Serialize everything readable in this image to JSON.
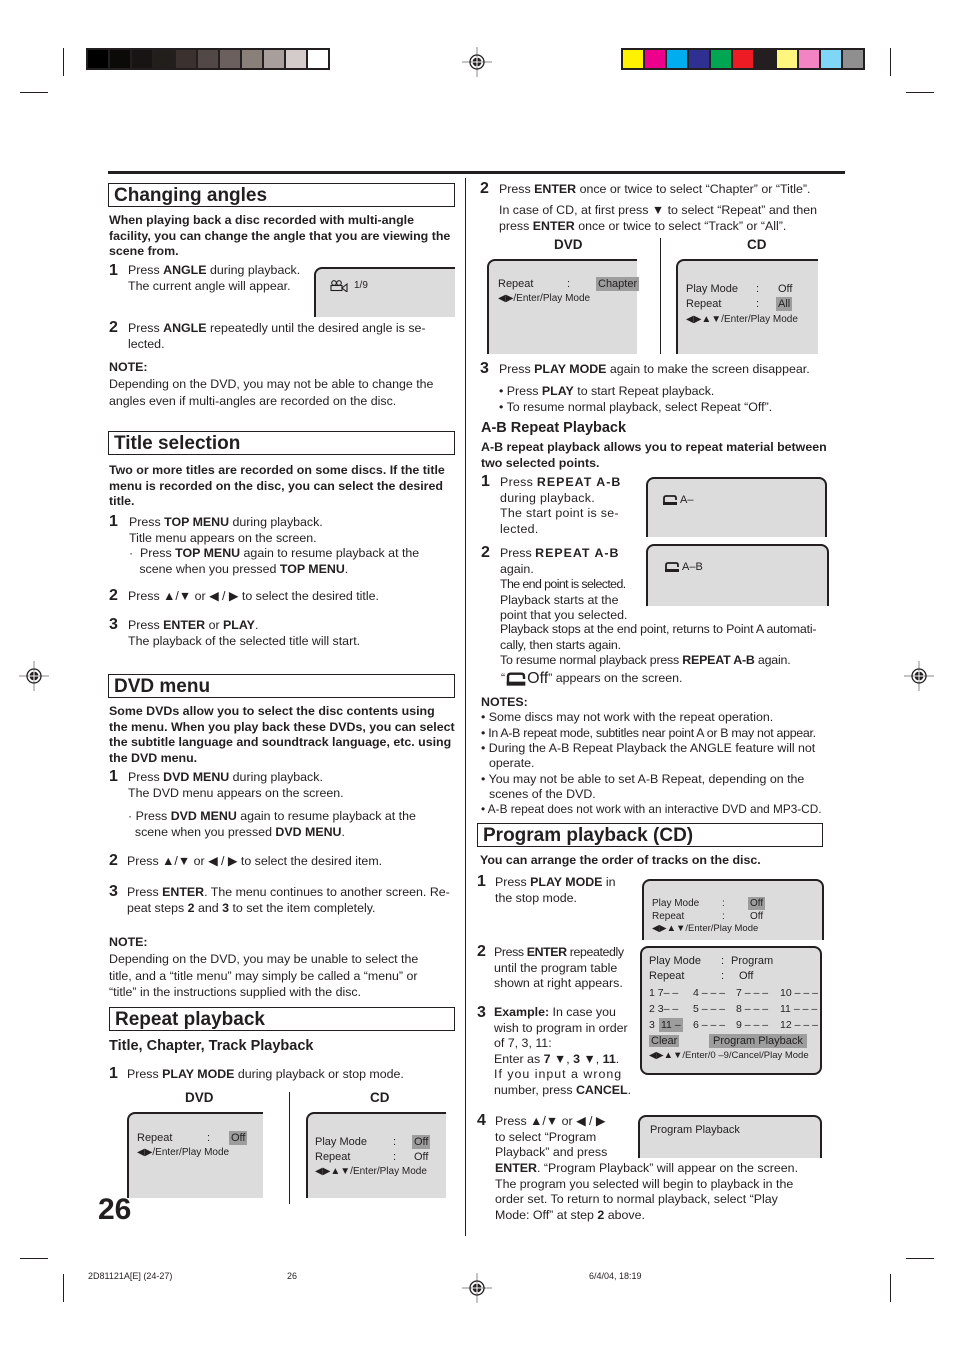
{
  "print_marks": {
    "gray_swatches": [
      "#000000",
      "#0c0a09",
      "#181413",
      "#221e1c",
      "#3b3230",
      "#524845",
      "#6b605d",
      "#888079",
      "#a89f9c",
      "#d3cccb",
      "#ffffff"
    ],
    "color_swatches": [
      "#fff200",
      "#ec008c",
      "#00aeef",
      "#2e3192",
      "#00a651",
      "#ed1c24",
      "#231f20",
      "#fff67f",
      "#f384c3",
      "#7fd6f7",
      "#8f8f8f"
    ]
  },
  "left": {
    "changing_angles": {
      "title": "Changing angles",
      "intro": "When playing back a disc recorded with multi-angle facility, you can change the angle that you are viewing the scene from.",
      "step1_num": "1",
      "step1_a": "Press ",
      "step1_b": "ANGLE",
      "step1_c": " during playback.",
      "step1_line2": "The current angle will appear.",
      "screen_value": "1/9",
      "step2_num": "2",
      "step2_a": "Press ",
      "step2_b": "ANGLE",
      "step2_c": " repeatedly until the desired angle is se-",
      "step2_line2": "lected.",
      "note_label": "NOTE:",
      "note_text": "Depending on the DVD, you may not be able to change the angles even if multi-angles are recorded on the disc."
    },
    "title_selection": {
      "title": "Title selection",
      "intro": "Two or more titles are recorded on some discs. If the title menu is recorded on the disc, you can select the desired title.",
      "step1_num": "1",
      "step1_a": "Press ",
      "step1_b": "TOP MENU",
      "step1_c": " during playback.",
      "step1_line2": "Title menu appears on the screen.",
      "bullet_a": "Press ",
      "bullet_b": "TOP MENU",
      "bullet_c": " again to resume playback at the",
      "bullet_line2_a": "scene when you pressed ",
      "bullet_line2_b": "TOP MENU",
      "bullet_line2_c": ".",
      "step2_num": "2",
      "step2_a": "Press",
      "step2_or": "or",
      "step2_c": "to select the desired title.",
      "step3_num": "3",
      "step3_a": "Press ",
      "step3_b": "ENTER",
      "step3_c": " or ",
      "step3_d": "PLAY",
      "step3_e": ".",
      "step3_line2": "The playback of the selected title will start."
    },
    "dvd_menu": {
      "title": "DVD menu",
      "intro": "Some DVDs allow you to select the disc contents using the menu. When you play back these DVDs, you can select the subtitle language and soundtrack language, etc. using the DVD menu.",
      "step1_num": "1",
      "step1_a": "Press ",
      "step1_b": "DVD MENU",
      "step1_c": " during playback.",
      "step1_line2": "The DVD menu appears on the screen.",
      "bullet_a": "Press ",
      "bullet_b": "DVD MENU",
      "bullet_c": " again to resume playback at the",
      "bullet_line2_a": "scene when you pressed ",
      "bullet_line2_b": "DVD MENU",
      "bullet_line2_c": ".",
      "step2_num": "2",
      "step2_a": "Press",
      "step2_or": "or",
      "step2_c": "to select the desired item.",
      "step3_num": "3",
      "step3_a": "Press ",
      "step3_b": "ENTER",
      "step3_c": ". The menu continues to another screen. Re-",
      "step3_line2_a": "peat steps ",
      "step3_line2_b": "2",
      "step3_line2_c": " and ",
      "step3_line2_d": "3",
      "step3_line2_e": " to set the item completely.",
      "note_label": "NOTE:",
      "note_text": "Depending on the DVD, you may be unable to select the title, and a “title menu” may simply be called a “menu” or “title” in the instructions supplied with the disc."
    },
    "repeat_playback": {
      "title": "Repeat playback",
      "subtitle": "Title, Chapter, Track Playback",
      "step1_num": "1",
      "step1_a": "Press ",
      "step1_b": "PLAY MODE",
      "step1_c": " during playback or stop mode.",
      "dvd_label": "DVD",
      "cd_label": "CD",
      "dvd_screen": {
        "row1_label": "Repeat",
        "row1_sep": ":",
        "row1_value": "Off",
        "hint": "◀▶/Enter/Play Mode"
      },
      "cd_screen": {
        "row1_label": "Play Mode",
        "row1_sep": ":",
        "row1_value": "Off",
        "row2_label": "Repeat",
        "row2_sep": ":",
        "row2_value": "Off",
        "hint": "◀▶▲▼/Enter/Play Mode"
      }
    },
    "page_number": "26"
  },
  "right": {
    "repeat_step2": {
      "num": "2",
      "line1_a": "Press ",
      "line1_b": "ENTER",
      "line1_c": " once or twice to select “Chapter” or “Title”.",
      "line2_a": "In case of CD, at first press",
      "line2_b": "to select “Repeat” and then",
      "line3_a": "press ",
      "line3_b": "ENTER",
      "line3_c": " once or twice to select “Track” or “All”.",
      "dvd_label": "DVD",
      "cd_label": "CD",
      "dvd_screen": {
        "row1_label": "Repeat",
        "row1_sep": ":",
        "row1_value": "Chapter",
        "hint": "◀▶/Enter/Play Mode"
      },
      "cd_screen": {
        "row1_label": "Play Mode",
        "row1_sep": ":",
        "row1_value": "Off",
        "row2_label": "Repeat",
        "row2_sep": ":",
        "row2_value": "All",
        "hint": "◀▶▲▼/Enter/Play Mode"
      }
    },
    "repeat_step3": {
      "num": "3",
      "line1_a": "Press ",
      "line1_b": "PLAY MODE",
      "line1_c": " again to make the screen disappear.",
      "bullet1_a": "Press ",
      "bullet1_b": "PLAY",
      "bullet1_c": " to start Repeat playback.",
      "bullet2": "To resume normal playback, select Repeat “Off”."
    },
    "ab_repeat": {
      "heading": "A-B Repeat Playback",
      "intro": "A-B repeat playback allows you to repeat material between two selected points.",
      "step1_num": "1",
      "step1_a": "Press ",
      "step1_b": "REPEAT A-B",
      "step1_line2": "during playback.",
      "step1_line3": "The start point is se-",
      "step1_line4": "lected.",
      "screen1": "A–",
      "step2_num": "2",
      "step2_a": "Press ",
      "step2_b": "REPEAT A-B",
      "step2_line2": "again.",
      "step2_line3": "The end point is selected.",
      "step2_line4": "Playback starts at the",
      "step2_line5": "point that you selected.",
      "step2_line6": "Playback stops at the end point, returns to Point A automati-",
      "step2_line7": "cally, then starts again.",
      "step2_line8_a": "To resume normal playback press ",
      "step2_line8_b": "REPEAT A-B",
      "step2_line8_c": " again.",
      "off_open": "“",
      "off_text": "Off",
      "off_close": "” appears on the screen.",
      "screen2": "A–B",
      "notes_label": "NOTES:",
      "notes": [
        "Some discs may not work with the  repeat operation.",
        "In A-B repeat mode, subtitles near point A or B may not appear.",
        "During the A-B Repeat Playback the ANGLE feature will not",
        "operate.",
        "You may not be able to set A-B Repeat, depending on the",
        "scenes of the DVD.",
        "A-B repeat does not work with an interactive DVD and MP3-CD."
      ]
    },
    "program": {
      "title": "Program playback (CD)",
      "intro": "You can arrange the order of tracks on the disc.",
      "step1_num": "1",
      "step1_a": "Press ",
      "step1_b": "PLAY MODE",
      "step1_c": " in",
      "step1_line2": "the stop mode.",
      "screen1": {
        "row1_label": "Play Mode",
        "row1_sep": ":",
        "row1_value": "Off",
        "row2_label": "Repeat",
        "row2_sep": ":",
        "row2_value": "Off",
        "hint": "◀▶▲▼/Enter/Play Mode"
      },
      "step2_num": "2",
      "step2_a": "Press ",
      "step2_b": "ENTER",
      "step2_c": " repeatedly",
      "step2_line2": "until the program table",
      "step2_line3": "shown at right appears.",
      "screen2": {
        "row1_label": "Play Mode",
        "row1_sep": ":",
        "row1_value": "Program",
        "row2_label": "Repeat",
        "row2_sep": ":",
        "row2_value": "Off",
        "slots": [
          [
            "1 7– –",
            "4 – – –",
            "7 – – –",
            "10 – – –"
          ],
          [
            "2 3– –",
            "5 – – –",
            "8 – – –",
            "11 – – –"
          ],
          [
            "3",
            "6 – – –",
            "9 – – –",
            "12 – – –"
          ]
        ],
        "active_slot": "11 –",
        "clear_label": "Clear",
        "program_playback_label": "Program Playback",
        "hint": "◀▶▲▼/Enter/0 –9/Cancel/Play Mode"
      },
      "step3_num": "3",
      "step3_a": "Example:",
      "step3_b": " In case you",
      "step3_line2": "wish to program in order",
      "step3_line3": "of 7, 3, 11:",
      "step3_line4_a": "Enter as ",
      "step3_line4_b": "7",
      "step3_line4_c": ", ",
      "step3_line4_d": "3",
      "step3_line4_e": ", ",
      "step3_line4_f": "11",
      "step3_line4_g": ".",
      "step3_line5": "If you input a wrong",
      "step3_line6_a": "number, press ",
      "step3_line6_b": "CANCEL",
      "step3_line6_c": ".",
      "step4_num": "4",
      "step4_a": "Press",
      "step4_or": "or",
      "step4_line2": "to select “Program",
      "step4_line3": "Playback” and press",
      "step4_line4_a": "ENTER",
      "step4_line4_b": ". “Program Playback” will appear on the screen.",
      "step4_line5": "The program you selected will begin to playback in the",
      "step4_line6": "order set. To return to normal playback, select “Play",
      "step4_line7_a": "Mode: Off” at step ",
      "step4_line7_b": "2",
      "step4_line7_c": " above.",
      "screen4": "Program Playback"
    }
  },
  "footer": {
    "code": "2D81121A[E] (24-27)",
    "page": "26",
    "date": "6/4/04, 18:19"
  }
}
